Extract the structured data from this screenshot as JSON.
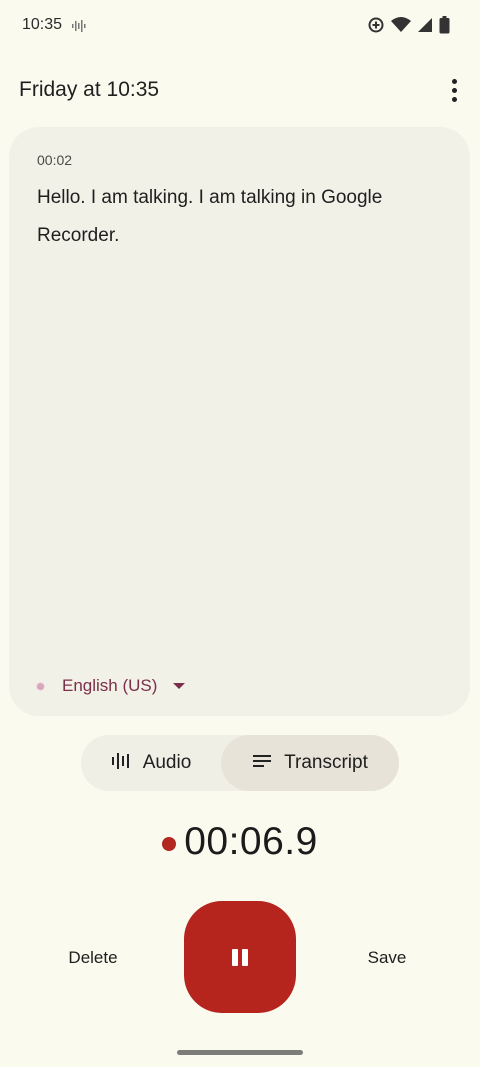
{
  "status_bar": {
    "time": "10:35",
    "icons": [
      "sound-wave-icon",
      "data-saver-icon",
      "wifi-icon",
      "signal-icon",
      "battery-icon"
    ]
  },
  "header": {
    "title": "Friday at 10:35",
    "more_icon": "more-vert-icon"
  },
  "transcript": {
    "segment_time": "00:02",
    "segment_text": "Hello. I am talking. I am talking in Google Recorder.",
    "language": "English (US)"
  },
  "view_toggle": {
    "audio_label": "Audio",
    "transcript_label": "Transcript",
    "selected": "Transcript"
  },
  "recording": {
    "elapsed": "00:06.9"
  },
  "controls": {
    "delete_label": "Delete",
    "save_label": "Save",
    "pause_icon": "pause-icon"
  },
  "colors": {
    "background": "#fafaef",
    "card": "#f2f1e8",
    "record_red": "#b6241e",
    "language_accent": "#7a2f4a"
  }
}
